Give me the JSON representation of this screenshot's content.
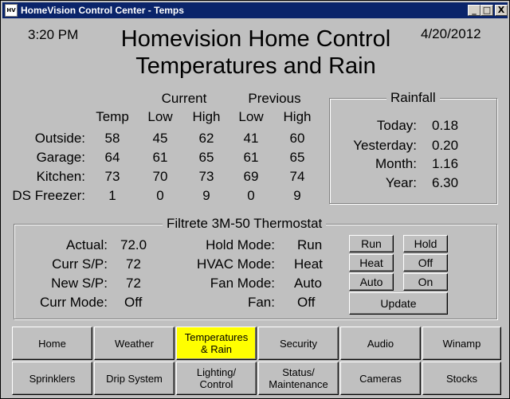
{
  "window": {
    "title": "HomeVision Control Center - Temps",
    "minimize": "_",
    "maximize": "□",
    "close": "X",
    "app_icon": "HV"
  },
  "header": {
    "time": "3:20 PM",
    "date": "4/20/2012",
    "title_line1": "Homevision Home Control",
    "title_line2": "Temperatures and Rain"
  },
  "temps": {
    "group_current": "Current",
    "group_previous": "Previous",
    "columns": [
      "Temp",
      "Low",
      "High",
      "Low",
      "High"
    ],
    "rows": [
      {
        "label": "Outside:",
        "values": [
          "58",
          "45",
          "62",
          "41",
          "60"
        ]
      },
      {
        "label": "Garage:",
        "values": [
          "64",
          "61",
          "65",
          "61",
          "65"
        ]
      },
      {
        "label": "Kitchen:",
        "values": [
          "73",
          "70",
          "73",
          "69",
          "74"
        ]
      },
      {
        "label": "DS Freezer:",
        "values": [
          "1",
          "0",
          "9",
          "0",
          "9"
        ]
      }
    ]
  },
  "rainfall": {
    "title": "Rainfall",
    "rows": [
      {
        "label": "Today:",
        "value": "0.18"
      },
      {
        "label": "Yesterday:",
        "value": "0.20"
      },
      {
        "label": "Month:",
        "value": "1.16"
      },
      {
        "label": "Year:",
        "value": "6.30"
      }
    ]
  },
  "thermostat": {
    "title": "Filtrete 3M-50 Thermostat",
    "left": [
      {
        "label": "Actual:",
        "value": "72.0"
      },
      {
        "label": "Curr S/P:",
        "value": "72"
      },
      {
        "label": "New S/P:",
        "value": "72"
      },
      {
        "label": "Curr Mode:",
        "value": "Off"
      }
    ],
    "right": [
      {
        "label": "Hold Mode:",
        "value": "Run"
      },
      {
        "label": "HVAC Mode:",
        "value": "Heat"
      },
      {
        "label": "Fan Mode:",
        "value": "Auto"
      },
      {
        "label": "Fan:",
        "value": "Off"
      }
    ],
    "buttons": {
      "run": "Run",
      "hold": "Hold",
      "heat": "Heat",
      "off": "Off",
      "auto": "Auto",
      "on": "On",
      "update": "Update"
    }
  },
  "nav": {
    "row1": [
      "Home",
      "Weather",
      "Temperatures\n& Rain",
      "Security",
      "Audio",
      "Winamp"
    ],
    "row2": [
      "Sprinklers",
      "Drip System",
      "Lighting/\nControl",
      "Status/\nMaintenance",
      "Cameras",
      "Stocks"
    ],
    "active_color": "#ffff00"
  }
}
